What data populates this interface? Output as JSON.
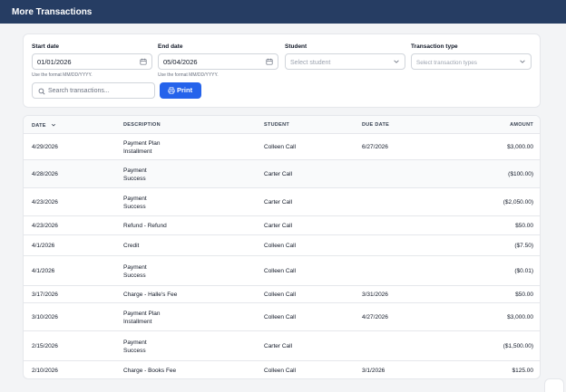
{
  "header": {
    "title": "More Transactions"
  },
  "filters": {
    "start_date": {
      "label": "Start date",
      "value": "01/01/2026",
      "hint": "Use the format MM/DD/YYYY."
    },
    "end_date": {
      "label": "End date",
      "value": "05/04/2026",
      "hint": "Use the format MM/DD/YYYY."
    },
    "student": {
      "label": "Student",
      "placeholder": "Select student"
    },
    "transaction_type": {
      "label": "Transaction type",
      "placeholder": "Select transaction types"
    },
    "search": {
      "placeholder": "Search transactions..."
    },
    "print_label": "Print"
  },
  "table": {
    "columns": {
      "date": "DATE",
      "description": "DESCRIPTION",
      "student": "STUDENT",
      "due_date": "DUE DATE",
      "amount": "AMOUNT"
    },
    "rows": [
      {
        "date": "4/29/2026",
        "desc1": "Payment Plan",
        "desc2": "Installment",
        "student": "Colleen Call",
        "due": "6/27/2026",
        "amount": "$3,000.00"
      },
      {
        "date": "4/28/2026",
        "desc1": "Payment",
        "desc2": "Success",
        "student": "Carter Call",
        "due": "",
        "amount": "($100.00)"
      },
      {
        "date": "4/23/2026",
        "desc1": "Payment",
        "desc2": "Success",
        "student": "Carter Call",
        "due": "",
        "amount": "($2,050.00)"
      },
      {
        "date": "4/23/2026",
        "desc1": "Refund - Refund",
        "desc2": "",
        "student": "Carter Call",
        "due": "",
        "amount": "$50.00"
      },
      {
        "date": "4/1/2026",
        "desc1": "Credit",
        "desc2": "",
        "student": "Colleen Call",
        "due": "",
        "amount": "($7.50)"
      },
      {
        "date": "4/1/2026",
        "desc1": "Payment",
        "desc2": "Success",
        "student": "Colleen Call",
        "due": "",
        "amount": "($0.01)"
      },
      {
        "date": "3/17/2026",
        "desc1": "Charge - Halle's Fee",
        "desc2": "",
        "student": "Colleen Call",
        "due": "3/31/2026",
        "amount": "$50.00"
      },
      {
        "date": "3/10/2026",
        "desc1": "Payment Plan",
        "desc2": "Installment",
        "student": "Colleen Call",
        "due": "4/27/2026",
        "amount": "$3,000.00"
      },
      {
        "date": "2/15/2026",
        "desc1": "Payment",
        "desc2": "Success",
        "student": "Carter Call",
        "due": "",
        "amount": "($1,500.00)"
      },
      {
        "date": "2/10/2026",
        "desc1": "Charge - Books Fee",
        "desc2": "",
        "student": "Colleen Call",
        "due": "3/1/2026",
        "amount": "$125.00"
      }
    ]
  },
  "colors": {
    "header_bg": "#263d63",
    "accent": "#2563eb"
  },
  "icons": {
    "date_field": "calendar-icon",
    "select": "chevron-down-icon",
    "search": "search-icon",
    "print": "printer-icon",
    "sort": "sort-desc-icon"
  }
}
